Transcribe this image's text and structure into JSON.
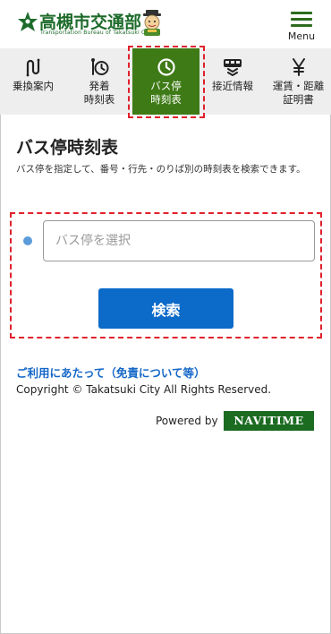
{
  "header": {
    "title": "高槻市交通部",
    "subtitle": "Transportation Bureau of Takatsuki City",
    "menu_label": "Menu"
  },
  "nav": {
    "items": [
      {
        "label": "乗換案内",
        "icon": "transfer-icon",
        "active": false
      },
      {
        "label": "発着\n時刻表",
        "icon": "departure-timetable-icon",
        "active": false
      },
      {
        "label": "バス停\n時刻表",
        "icon": "clock-icon",
        "active": true
      },
      {
        "label": "接近情報",
        "icon": "bus-approach-icon",
        "active": false
      },
      {
        "label": "運賃・距離\n証明書",
        "icon": "yen-icon",
        "active": false
      }
    ]
  },
  "main": {
    "title": "バス停時刻表",
    "description": "バス停を指定して、番号・行先・のりば別の時刻表を検索できます。",
    "stop_placeholder": "バス停を選択",
    "stop_value": "",
    "search_label": "検索"
  },
  "footer": {
    "terms_link": "ご利用にあたって（免責について等）",
    "copyright": "Copyright © Takatsuki City All Rights Reserved.",
    "powered_by": "Powered by",
    "navitime": "NAVITIME"
  },
  "colors": {
    "brand_green": "#3e7a16",
    "primary_blue": "#0c6ac9",
    "link_blue": "#1668c8",
    "highlight_red": "#e0202c"
  }
}
